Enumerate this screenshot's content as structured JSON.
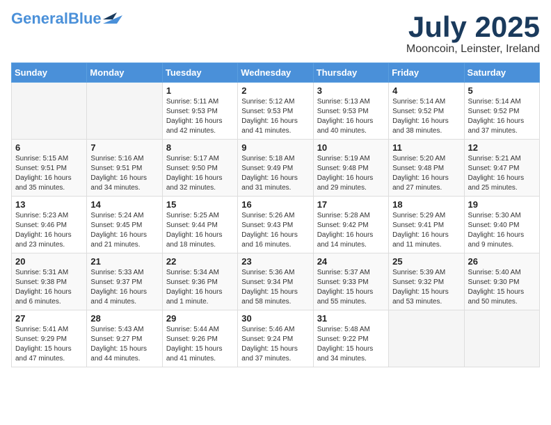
{
  "header": {
    "logo_line1": "General",
    "logo_line2": "Blue",
    "month": "July 2025",
    "location": "Mooncoin, Leinster, Ireland"
  },
  "weekdays": [
    "Sunday",
    "Monday",
    "Tuesday",
    "Wednesday",
    "Thursday",
    "Friday",
    "Saturday"
  ],
  "weeks": [
    [
      {
        "day": "",
        "info": ""
      },
      {
        "day": "",
        "info": ""
      },
      {
        "day": "1",
        "info": "Sunrise: 5:11 AM\nSunset: 9:53 PM\nDaylight: 16 hours\nand 42 minutes."
      },
      {
        "day": "2",
        "info": "Sunrise: 5:12 AM\nSunset: 9:53 PM\nDaylight: 16 hours\nand 41 minutes."
      },
      {
        "day": "3",
        "info": "Sunrise: 5:13 AM\nSunset: 9:53 PM\nDaylight: 16 hours\nand 40 minutes."
      },
      {
        "day": "4",
        "info": "Sunrise: 5:14 AM\nSunset: 9:52 PM\nDaylight: 16 hours\nand 38 minutes."
      },
      {
        "day": "5",
        "info": "Sunrise: 5:14 AM\nSunset: 9:52 PM\nDaylight: 16 hours\nand 37 minutes."
      }
    ],
    [
      {
        "day": "6",
        "info": "Sunrise: 5:15 AM\nSunset: 9:51 PM\nDaylight: 16 hours\nand 35 minutes."
      },
      {
        "day": "7",
        "info": "Sunrise: 5:16 AM\nSunset: 9:51 PM\nDaylight: 16 hours\nand 34 minutes."
      },
      {
        "day": "8",
        "info": "Sunrise: 5:17 AM\nSunset: 9:50 PM\nDaylight: 16 hours\nand 32 minutes."
      },
      {
        "day": "9",
        "info": "Sunrise: 5:18 AM\nSunset: 9:49 PM\nDaylight: 16 hours\nand 31 minutes."
      },
      {
        "day": "10",
        "info": "Sunrise: 5:19 AM\nSunset: 9:48 PM\nDaylight: 16 hours\nand 29 minutes."
      },
      {
        "day": "11",
        "info": "Sunrise: 5:20 AM\nSunset: 9:48 PM\nDaylight: 16 hours\nand 27 minutes."
      },
      {
        "day": "12",
        "info": "Sunrise: 5:21 AM\nSunset: 9:47 PM\nDaylight: 16 hours\nand 25 minutes."
      }
    ],
    [
      {
        "day": "13",
        "info": "Sunrise: 5:23 AM\nSunset: 9:46 PM\nDaylight: 16 hours\nand 23 minutes."
      },
      {
        "day": "14",
        "info": "Sunrise: 5:24 AM\nSunset: 9:45 PM\nDaylight: 16 hours\nand 21 minutes."
      },
      {
        "day": "15",
        "info": "Sunrise: 5:25 AM\nSunset: 9:44 PM\nDaylight: 16 hours\nand 18 minutes."
      },
      {
        "day": "16",
        "info": "Sunrise: 5:26 AM\nSunset: 9:43 PM\nDaylight: 16 hours\nand 16 minutes."
      },
      {
        "day": "17",
        "info": "Sunrise: 5:28 AM\nSunset: 9:42 PM\nDaylight: 16 hours\nand 14 minutes."
      },
      {
        "day": "18",
        "info": "Sunrise: 5:29 AM\nSunset: 9:41 PM\nDaylight: 16 hours\nand 11 minutes."
      },
      {
        "day": "19",
        "info": "Sunrise: 5:30 AM\nSunset: 9:40 PM\nDaylight: 16 hours\nand 9 minutes."
      }
    ],
    [
      {
        "day": "20",
        "info": "Sunrise: 5:31 AM\nSunset: 9:38 PM\nDaylight: 16 hours\nand 6 minutes."
      },
      {
        "day": "21",
        "info": "Sunrise: 5:33 AM\nSunset: 9:37 PM\nDaylight: 16 hours\nand 4 minutes."
      },
      {
        "day": "22",
        "info": "Sunrise: 5:34 AM\nSunset: 9:36 PM\nDaylight: 16 hours\nand 1 minute."
      },
      {
        "day": "23",
        "info": "Sunrise: 5:36 AM\nSunset: 9:34 PM\nDaylight: 15 hours\nand 58 minutes."
      },
      {
        "day": "24",
        "info": "Sunrise: 5:37 AM\nSunset: 9:33 PM\nDaylight: 15 hours\nand 55 minutes."
      },
      {
        "day": "25",
        "info": "Sunrise: 5:39 AM\nSunset: 9:32 PM\nDaylight: 15 hours\nand 53 minutes."
      },
      {
        "day": "26",
        "info": "Sunrise: 5:40 AM\nSunset: 9:30 PM\nDaylight: 15 hours\nand 50 minutes."
      }
    ],
    [
      {
        "day": "27",
        "info": "Sunrise: 5:41 AM\nSunset: 9:29 PM\nDaylight: 15 hours\nand 47 minutes."
      },
      {
        "day": "28",
        "info": "Sunrise: 5:43 AM\nSunset: 9:27 PM\nDaylight: 15 hours\nand 44 minutes."
      },
      {
        "day": "29",
        "info": "Sunrise: 5:44 AM\nSunset: 9:26 PM\nDaylight: 15 hours\nand 41 minutes."
      },
      {
        "day": "30",
        "info": "Sunrise: 5:46 AM\nSunset: 9:24 PM\nDaylight: 15 hours\nand 37 minutes."
      },
      {
        "day": "31",
        "info": "Sunrise: 5:48 AM\nSunset: 9:22 PM\nDaylight: 15 hours\nand 34 minutes."
      },
      {
        "day": "",
        "info": ""
      },
      {
        "day": "",
        "info": ""
      }
    ]
  ]
}
